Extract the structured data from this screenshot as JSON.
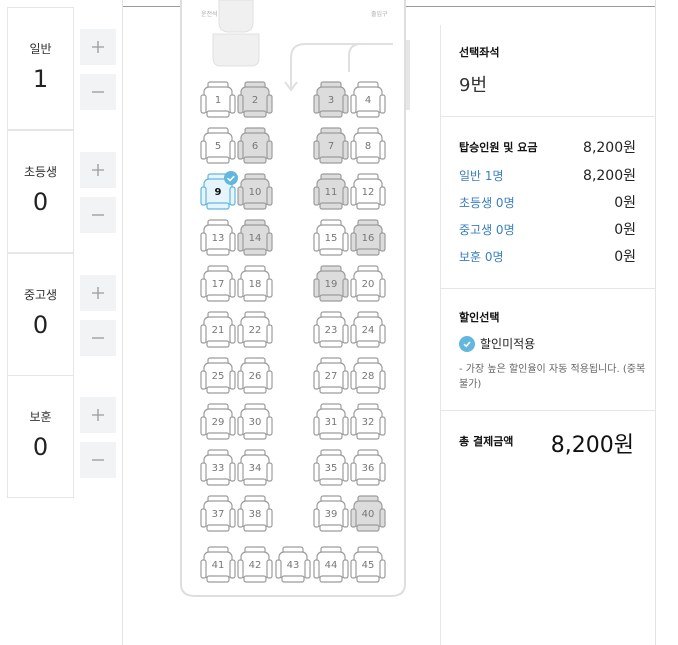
{
  "passengers": [
    {
      "name": "일반",
      "count": "1"
    },
    {
      "name": "초등생",
      "count": "0"
    },
    {
      "name": "중고생",
      "count": "0"
    },
    {
      "name": "보훈",
      "count": "0"
    }
  ],
  "bus": {
    "labels": {
      "driver": "운전석",
      "door": "출입구"
    },
    "seats": [
      {
        "num": "1",
        "state": "available"
      },
      {
        "num": "2",
        "state": "taken"
      },
      {
        "num": "3",
        "state": "taken"
      },
      {
        "num": "4",
        "state": "available"
      },
      {
        "num": "5",
        "state": "available"
      },
      {
        "num": "6",
        "state": "taken"
      },
      {
        "num": "7",
        "state": "taken"
      },
      {
        "num": "8",
        "state": "available"
      },
      {
        "num": "9",
        "state": "selected"
      },
      {
        "num": "10",
        "state": "taken"
      },
      {
        "num": "11",
        "state": "taken"
      },
      {
        "num": "12",
        "state": "available"
      },
      {
        "num": "13",
        "state": "available"
      },
      {
        "num": "14",
        "state": "taken"
      },
      {
        "num": "15",
        "state": "available"
      },
      {
        "num": "16",
        "state": "taken"
      },
      {
        "num": "17",
        "state": "available"
      },
      {
        "num": "18",
        "state": "available"
      },
      {
        "num": "19",
        "state": "taken"
      },
      {
        "num": "20",
        "state": "available"
      },
      {
        "num": "21",
        "state": "available"
      },
      {
        "num": "22",
        "state": "available"
      },
      {
        "num": "23",
        "state": "available"
      },
      {
        "num": "24",
        "state": "available"
      },
      {
        "num": "25",
        "state": "available"
      },
      {
        "num": "26",
        "state": "available"
      },
      {
        "num": "27",
        "state": "available"
      },
      {
        "num": "28",
        "state": "available"
      },
      {
        "num": "29",
        "state": "available"
      },
      {
        "num": "30",
        "state": "available"
      },
      {
        "num": "31",
        "state": "available"
      },
      {
        "num": "32",
        "state": "available"
      },
      {
        "num": "33",
        "state": "available"
      },
      {
        "num": "34",
        "state": "available"
      },
      {
        "num": "35",
        "state": "available"
      },
      {
        "num": "36",
        "state": "available"
      },
      {
        "num": "37",
        "state": "available"
      },
      {
        "num": "38",
        "state": "available"
      },
      {
        "num": "39",
        "state": "available"
      },
      {
        "num": "40",
        "state": "taken"
      },
      {
        "num": "41",
        "state": "available"
      },
      {
        "num": "42",
        "state": "available"
      },
      {
        "num": "43",
        "state": "available"
      },
      {
        "num": "44",
        "state": "available"
      },
      {
        "num": "45",
        "state": "available"
      }
    ]
  },
  "summary": {
    "selected_label": "선택좌석",
    "selected_seat": "9번",
    "fare_header": "탑승인원 및 요금",
    "fare_total": "8,200원",
    "fares": [
      {
        "label": "일반 1명",
        "amount": "8,200원"
      },
      {
        "label": "초등생 0명",
        "amount": "0원"
      },
      {
        "label": "중고생 0명",
        "amount": "0원"
      },
      {
        "label": "보훈 0명",
        "amount": "0원"
      }
    ],
    "discount_label": "할인선택",
    "discount_option": "할인미적용",
    "discount_note": "- 가장 높은 할인율이 자동 적용됩니다. (중복불가)",
    "total_label": "총 결제금액",
    "total_amount": "8,200원"
  },
  "colors": {
    "accent": "#63b6dd",
    "link": "#3a7fbf",
    "taken": "#dcdcdc",
    "button_bg": "#f2f3f5"
  }
}
